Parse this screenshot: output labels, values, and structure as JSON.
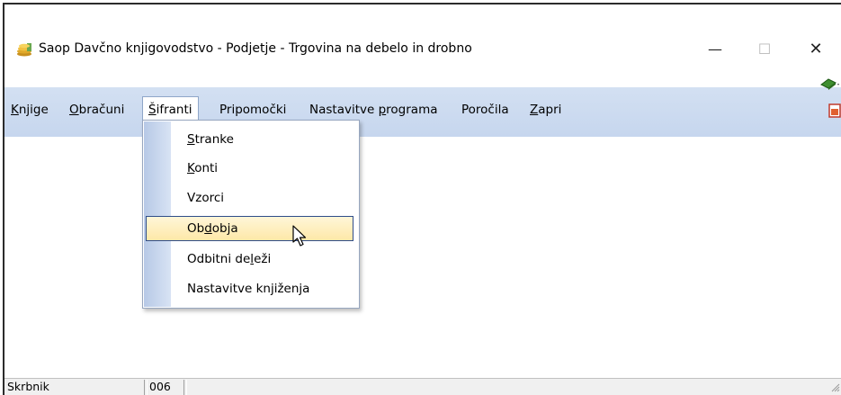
{
  "window": {
    "title": "Saop Davčno knjigovodstvo - Podjetje - Trgovina na debelo in drobno",
    "controls": {
      "minimize": "—",
      "maximize": "☐",
      "close": "✕"
    }
  },
  "menubar": {
    "items": [
      {
        "pre": "",
        "key": "K",
        "post": "njige"
      },
      {
        "pre": "",
        "key": "O",
        "post": "bračuni"
      },
      {
        "pre": "",
        "key": "Š",
        "post": "ifranti"
      },
      {
        "pre": "Pripomočki",
        "key": "",
        "post": ""
      },
      {
        "pre": "Nastavitve ",
        "key": "p",
        "post": "rograma"
      },
      {
        "pre": "Poročila",
        "key": "",
        "post": ""
      },
      {
        "pre": "",
        "key": "Z",
        "post": "apri"
      }
    ]
  },
  "dropdown": {
    "items": [
      {
        "pre": "",
        "key": "S",
        "post": "tranke"
      },
      {
        "pre": "",
        "key": "K",
        "post": "onti"
      },
      {
        "pre": "Vzorci",
        "key": "",
        "post": ""
      },
      {
        "pre": "Ob",
        "key": "d",
        "post": "obja"
      },
      {
        "pre": "Odbitni de",
        "key": "l",
        "post": "eži"
      },
      {
        "pre": "Nastavitve knjiženja",
        "key": "",
        "post": ""
      }
    ],
    "highlighted_index": 3
  },
  "statusbar": {
    "user": "Skrbnik",
    "code": "006"
  },
  "colors": {
    "menubar": "#c9d8ee",
    "highlight": "#fde8a8",
    "highlight_border": "#2f4d8a"
  }
}
